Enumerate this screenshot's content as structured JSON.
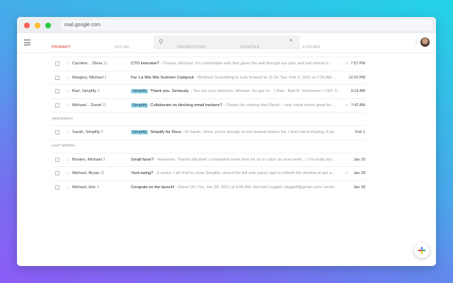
{
  "browser": {
    "url": "mail.google.com"
  },
  "tabs": [
    {
      "label": "PRIMARY"
    },
    {
      "label": "SOCIAL"
    },
    {
      "label": "PROMOTIONS"
    },
    {
      "label": "UPDATES"
    },
    {
      "label": "FORUMS"
    }
  ],
  "groups": [
    {
      "label": "",
      "rows": [
        {
          "from": "Caroline .. Shiva",
          "count": "12",
          "label": "",
          "subject": "CTO interview?",
          "snippet": " - Thanks, Michael. I'm comfortable with that given the well thought-out plan and last minute ti...",
          "attachment": true,
          "date": "7:57 PM"
        },
        {
          "from": "Margery, Michael",
          "count": "2",
          "label": "",
          "subject": "Fw: La Wis Wis Summer Campout",
          "snippet": " - Woohoo! Something to look forward to :D On Tue, Feb 2, 2021 at 7:30 AM ...",
          "attachment": false,
          "date": "12:10 PM"
        },
        {
          "from": "Bart, Simplify",
          "count": "3",
          "label": "Simplify",
          "subject": "Thank you. Seriously.",
          "snippet": " - You are very welcome, Michael. Go get 'm. : ) Bart - Bart R. Verhoeven • CEF S...",
          "attachment": false,
          "date": "9:16 AM"
        },
        {
          "from": "Michael .. David",
          "count": "11",
          "label": "Simplify",
          "subject": "Collaborate on blocking email trackers?",
          "snippet": " - Thanks for sharing that David -- over email works great for ...",
          "attachment": true,
          "date": "7:42 AM"
        }
      ]
    },
    {
      "label": "YESTERDAY",
      "rows": [
        {
          "from": "Sarah, Simplify",
          "count": "2",
          "label": "Simplify",
          "subject": "Simplify for Docs",
          "snippet": " - Hi Sarah, Since you're already on the trusted testers list, I don't mind sharing. It do...",
          "attachment": false,
          "date": "Feb 1"
        }
      ]
    },
    {
      "label": "LAST MONTH",
      "rows": [
        {
          "from": "Broden, Michael",
          "count": "3",
          "label": "",
          "subject": "Small favor?",
          "snippet": " - Awesome. Thanks Micahel! I scheduled some time for us to catch up next week. : ) I'm really loo...",
          "attachment": false,
          "date": "Jan 29"
        },
        {
          "from": "Michael, Bryan",
          "count": "22",
          "label": "",
          "subject": "Yard swing?",
          "snippet": " - It works. I alt-S'ed to close Simplify, closed the left side panel, had to refresh the window to get a...",
          "attachment": true,
          "date": "Jan 28"
        },
        {
          "from": "Michael, Eric",
          "count": "4",
          "label": "",
          "subject": "Congrats on the launch!",
          "snippet": " - Done! On Thu, Jan 28, 2021 at 9:55 AM, Michael Leggett <leggett@gmail.com> wrote...",
          "attachment": false,
          "date": "Jan 28"
        }
      ]
    }
  ],
  "colors": {
    "accent": "#d93025",
    "label": "#8fd3e6"
  }
}
